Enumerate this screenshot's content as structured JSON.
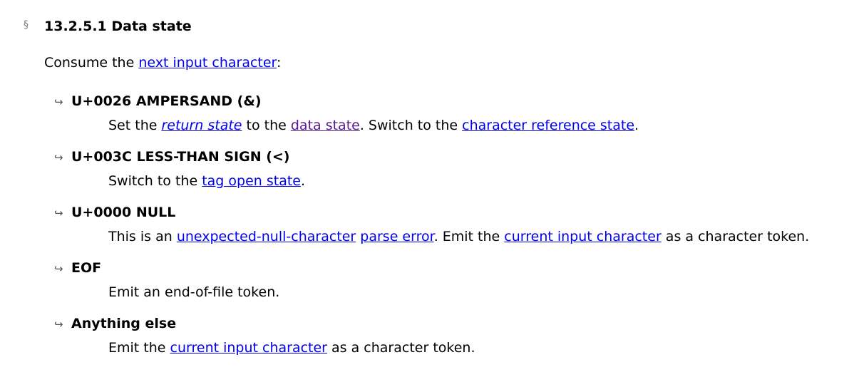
{
  "section": {
    "mark": "§",
    "heading": "13.2.5.1 Data state"
  },
  "intro": {
    "before": "Consume the ",
    "link": "next input character",
    "after": ":"
  },
  "cases": [
    {
      "arrow": "↪",
      "term": "U+0026 AMPERSAND (&)",
      "parts": {
        "t1": "Set the ",
        "l1": "return state",
        "t2": " to the ",
        "l2": "data state",
        "t3": ". Switch to the ",
        "l3": "character reference state",
        "t4": "."
      }
    },
    {
      "arrow": "↪",
      "term": "U+003C LESS-THAN SIGN (<)",
      "parts": {
        "t1": "Switch to the ",
        "l1": "tag open state",
        "t2": "."
      }
    },
    {
      "arrow": "↪",
      "term": "U+0000 NULL",
      "parts": {
        "t1": "This is an ",
        "l1": "unexpected-null-character",
        "t2": " ",
        "l2": "parse error",
        "t3": ". Emit the ",
        "l3": "current input character",
        "t4": " as a character token."
      }
    },
    {
      "arrow": "↪",
      "term": "EOF",
      "parts": {
        "t1": "Emit an end-of-file token."
      }
    },
    {
      "arrow": "↪",
      "term": "Anything else",
      "parts": {
        "t1": "Emit the ",
        "l1": "current input character",
        "t2": " as a character token."
      }
    }
  ],
  "colors": {
    "link": "#0000ee",
    "visited_link": "#551a8b",
    "text": "#000000",
    "section_mark": "#777777"
  }
}
